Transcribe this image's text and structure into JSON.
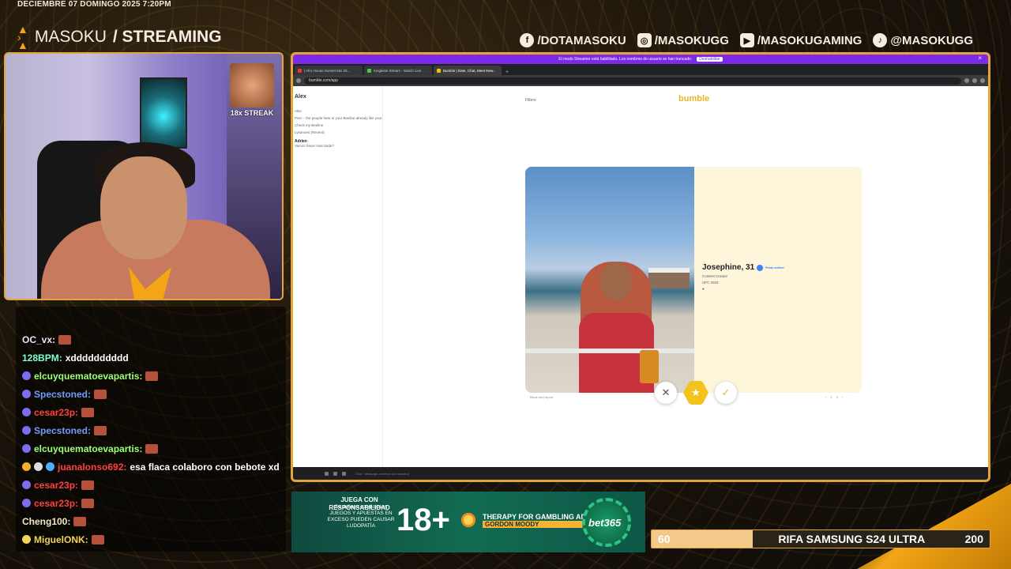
{
  "overlay": {
    "date": "DECIEMBRE 07 DOMINGO 2025 7:20PM",
    "brand_name": "MASOKU",
    "brand_section": "/ STREAMING",
    "socials": [
      {
        "icon": "facebook-icon",
        "label": "/DOTAMASOKU"
      },
      {
        "icon": "instagram-icon",
        "label": "/MASOKUGG"
      },
      {
        "icon": "youtube-icon",
        "label": "/MASOKUGAMING"
      },
      {
        "icon": "tiktok-icon",
        "label": "@MASOKUGG"
      }
    ],
    "streak": "18x STREAK"
  },
  "chat": [
    {
      "user": "OC_vx:",
      "color": "#e6e6ff",
      "text": ""
    },
    {
      "user": "128BPM:",
      "color": "#7fffd4",
      "text": "xdddddddddd"
    },
    {
      "user": "elcuyquematoevapartis:",
      "color": "#9dff7a",
      "text": ""
    },
    {
      "user": "Specstoned:",
      "color": "#6f9bff",
      "text": ""
    },
    {
      "user": "cesar23p:",
      "color": "#ff4040",
      "text": ""
    },
    {
      "user": "Specstoned:",
      "color": "#6f9bff",
      "text": ""
    },
    {
      "user": "elcuyquematoevapartis:",
      "color": "#9dff7a",
      "text": ""
    },
    {
      "user": "juanalonso692:",
      "color": "#ff4040",
      "text": "esa flaca colaboro con bebote xd"
    },
    {
      "user": "cesar23p:",
      "color": "#ff4040",
      "text": ""
    },
    {
      "user": "cesar23p:",
      "color": "#ff4040",
      "text": ""
    },
    {
      "user": "Cheng100:",
      "color": "#f1e7c7",
      "text": ""
    },
    {
      "user": "MiguelONK:",
      "color": "#f3d35a",
      "text": ""
    }
  ],
  "browser": {
    "notice": "El modo Streamer está habilitado. Los nombres de usuario se han truncado.",
    "notice_button": "Deshabilitar",
    "tabs": [
      {
        "label": "| Afro House Sunset Mix 20...",
        "color": "#e33",
        "active": false
      },
      {
        "label": "Kingkiste Stream - Watch Live...",
        "color": "#4c4",
        "active": false
      },
      {
        "label": "Bumble | Date, Chat, Meet New...",
        "color": "#f2c200",
        "active": true
      }
    ],
    "url": "bumble.com/app",
    "left_pane": {
      "name": "Alex",
      "line1": "Alex",
      "line2": "Psst -- the people here in your Beeline already like you!",
      "line3": "Check my Beeline",
      "line4": "Lysanoes  (Recent)",
      "line5": "Adrien",
      "line6": "Vamos hacer mas tarde?"
    },
    "filter": "Filters",
    "logo": "bumble",
    "profile": {
      "name": "Josephine, 31",
      "verified": "Photo verified",
      "job": "Content Creator",
      "school": "UFC 2016"
    },
    "block": "Block and report",
    "pager": [
      "‹",
      "1",
      "2",
      "›"
    ],
    "message_placeholder": "Chat · Message a stream (as masoku)"
  },
  "ad": {
    "line1": "JUEGA CON RESPONSABILIDAD",
    "line2": "Se aplican condiciones",
    "line3": "JUEGOS Y APUESTAS EN EXCESO PUEDEN CAUSAR LUDOPATÍA",
    "age": "18+",
    "therapy": "THERAPY FOR GAMBLING ADDICTION",
    "gordon": "GORDON MOODY",
    "bet": "bet365"
  },
  "raffle": {
    "current": "60",
    "title": "RIFA SAMSUNG S24 ULTRA",
    "goal": "200",
    "progress": 0.3
  }
}
